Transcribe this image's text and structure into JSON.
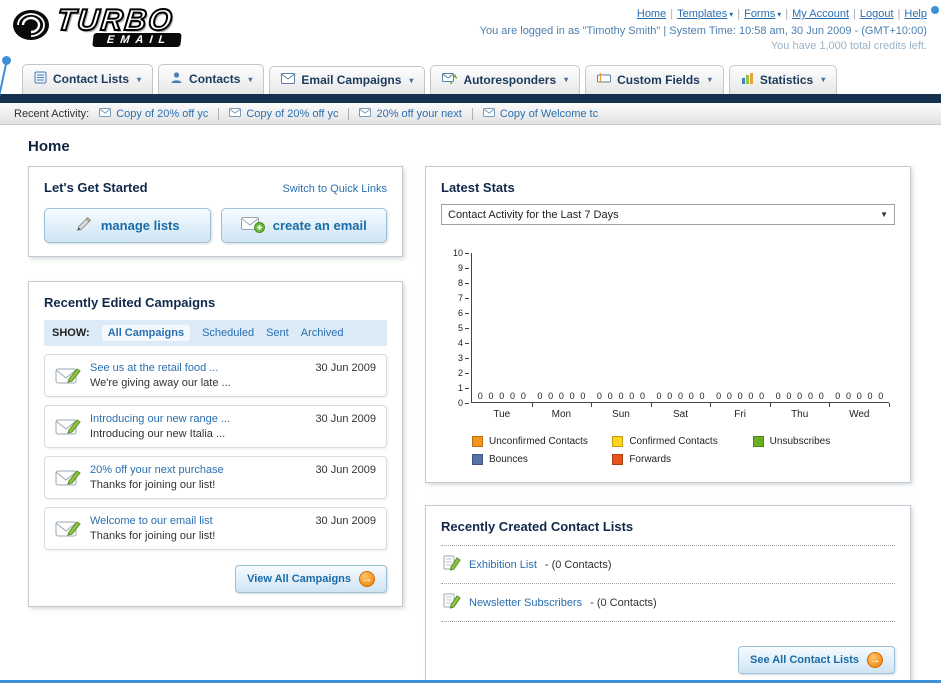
{
  "icons": {
    "chevron_down": "▾",
    "select_arrow": "▼",
    "arrow_right": "→",
    "separator": "|"
  },
  "header": {
    "logo_line1": "TURBO",
    "logo_line2": "EMAIL",
    "links": [
      {
        "label": "Home"
      },
      {
        "label": "Templates"
      },
      {
        "label": "Forms"
      },
      {
        "label": "My Account"
      },
      {
        "label": "Logout"
      },
      {
        "label": "Help"
      }
    ],
    "login_status": "You are logged in as \"Timothy Smith\" | System Time: 10:58 am, 30 Jun 2009 - (GMT+10:00)",
    "credits": "You have 1,000 total credits left."
  },
  "nav_tabs": [
    {
      "label": "Contact Lists"
    },
    {
      "label": "Contacts"
    },
    {
      "label": "Email Campaigns"
    },
    {
      "label": "Autoresponders"
    },
    {
      "label": "Custom Fields"
    },
    {
      "label": "Statistics"
    }
  ],
  "recent_activity": {
    "label": "Recent Activity:",
    "items": [
      {
        "label": "Copy of 20% off yc"
      },
      {
        "label": "Copy of 20% off yc"
      },
      {
        "label": "20% off your next"
      },
      {
        "label": "Copy of Welcome tc"
      }
    ]
  },
  "page_title": "Home",
  "get_started": {
    "title": "Let's Get Started",
    "switch_link": "Switch to Quick Links",
    "manage_lists_label": "manage lists",
    "create_email_label": "create an email"
  },
  "campaigns": {
    "title": "Recently Edited Campaigns",
    "show_label": "SHOW:",
    "filters": [
      {
        "label": "All Campaigns"
      },
      {
        "label": "Scheduled"
      },
      {
        "label": "Sent"
      },
      {
        "label": "Archived"
      }
    ],
    "items": [
      {
        "title": "See us at the retail food ...",
        "subtitle": "We're giving away our late ...",
        "date": "30 Jun 2009"
      },
      {
        "title": "Introducing our new range ...",
        "subtitle": "Introducing our new Italia ...",
        "date": "30 Jun 2009"
      },
      {
        "title": "20% off your next purchase",
        "subtitle": "Thanks for joining our list!",
        "date": "30 Jun 2009"
      },
      {
        "title": "Welcome to our email list",
        "subtitle": "Thanks for joining our list!",
        "date": "30 Jun 2009"
      }
    ],
    "view_all_label": "View All Campaigns"
  },
  "latest_stats": {
    "title": "Latest Stats",
    "selector_value": "Contact Activity for the Last 7 Days",
    "chart_data": {
      "type": "bar",
      "categories": [
        "Tue",
        "Mon",
        "Sun",
        "Sat",
        "Fri",
        "Thu",
        "Wed"
      ],
      "series": [
        {
          "name": "Unconfirmed Contacts",
          "color": "#f7941d",
          "values": [
            0,
            0,
            0,
            0,
            0,
            0,
            0
          ]
        },
        {
          "name": "Confirmed Contacts",
          "color": "#ffd51c",
          "values": [
            0,
            0,
            0,
            0,
            0,
            0,
            0
          ]
        },
        {
          "name": "Unsubscribes",
          "color": "#6ab023",
          "values": [
            0,
            0,
            0,
            0,
            0,
            0,
            0
          ]
        },
        {
          "name": "Bounces",
          "color": "#5572a7",
          "values": [
            0,
            0,
            0,
            0,
            0,
            0,
            0
          ]
        },
        {
          "name": "Forwards",
          "color": "#e8541d",
          "values": [
            0,
            0,
            0,
            0,
            0,
            0,
            0
          ]
        }
      ],
      "ylim": [
        0,
        10
      ],
      "yticks": [
        0,
        1,
        2,
        3,
        4,
        5,
        6,
        7,
        8,
        9,
        10
      ],
      "legend_position": "bottom",
      "grid": false
    }
  },
  "contact_lists": {
    "title": "Recently Created Contact Lists",
    "items": [
      {
        "name": "Exhibition List",
        "suffix": "- (0 Contacts)"
      },
      {
        "name": "Newsletter Subscribers",
        "suffix": "- (0 Contacts)"
      }
    ],
    "see_all_label": "See All Contact Lists"
  }
}
